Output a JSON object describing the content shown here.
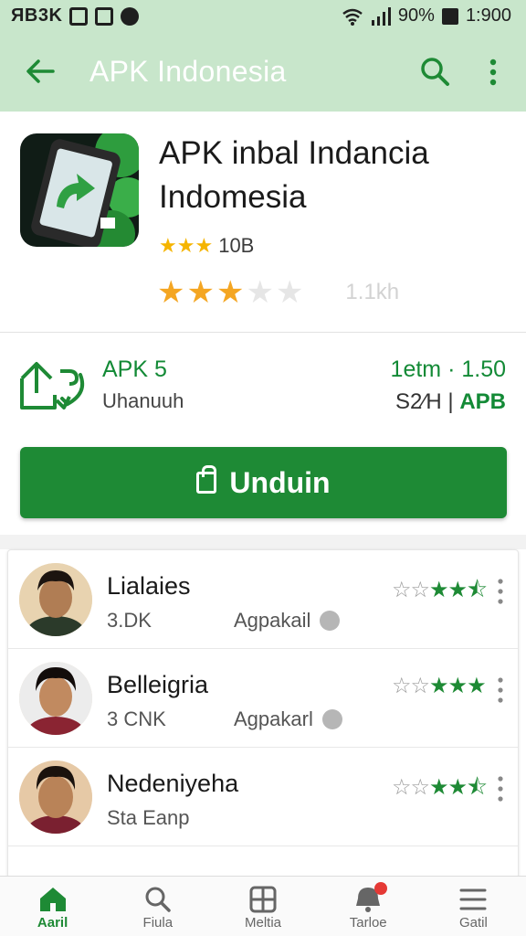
{
  "status_bar": {
    "left_text": "ЯB3K",
    "percent": "90%",
    "time": "1:900"
  },
  "app_bar": {
    "title": "APK Indonesia"
  },
  "app": {
    "name": "APK inbal Indancia Indomesia",
    "rating_count": "10B",
    "rating_stars": 3,
    "size_label": "1.1kh"
  },
  "info": {
    "version": "APK 5",
    "sub": "Uhanuuh",
    "date": "1etm · 1.50",
    "size": "S2⁄H |",
    "size_accent": "APB"
  },
  "download": {
    "label": "Unduin"
  },
  "reviews": [
    {
      "name": "Lialaies",
      "meta": "3.DK",
      "tag": "Agpakail",
      "stars_filled": 2.5
    },
    {
      "name": "Belleigria",
      "meta": "3 CNK",
      "tag": "Agpakarl",
      "stars_filled": 3
    },
    {
      "name": "Nedeniyeha",
      "meta": "Sta Eanp",
      "tag": "",
      "stars_filled": 2.5
    }
  ],
  "bottom_nav": [
    {
      "label": "Aaril",
      "icon": "home-icon",
      "active": true
    },
    {
      "label": "Fiula",
      "icon": "search-icon",
      "active": false
    },
    {
      "label": "Meltia",
      "icon": "apps-grid-icon",
      "active": false
    },
    {
      "label": "Tarloe",
      "icon": "notification-icon",
      "active": false,
      "badge": true
    },
    {
      "label": "Gatil",
      "icon": "menu-icon",
      "active": false
    }
  ],
  "colors": {
    "accent": "#1e8a35",
    "appbar_bg": "#c8e6cb",
    "star": "#f4a623"
  }
}
